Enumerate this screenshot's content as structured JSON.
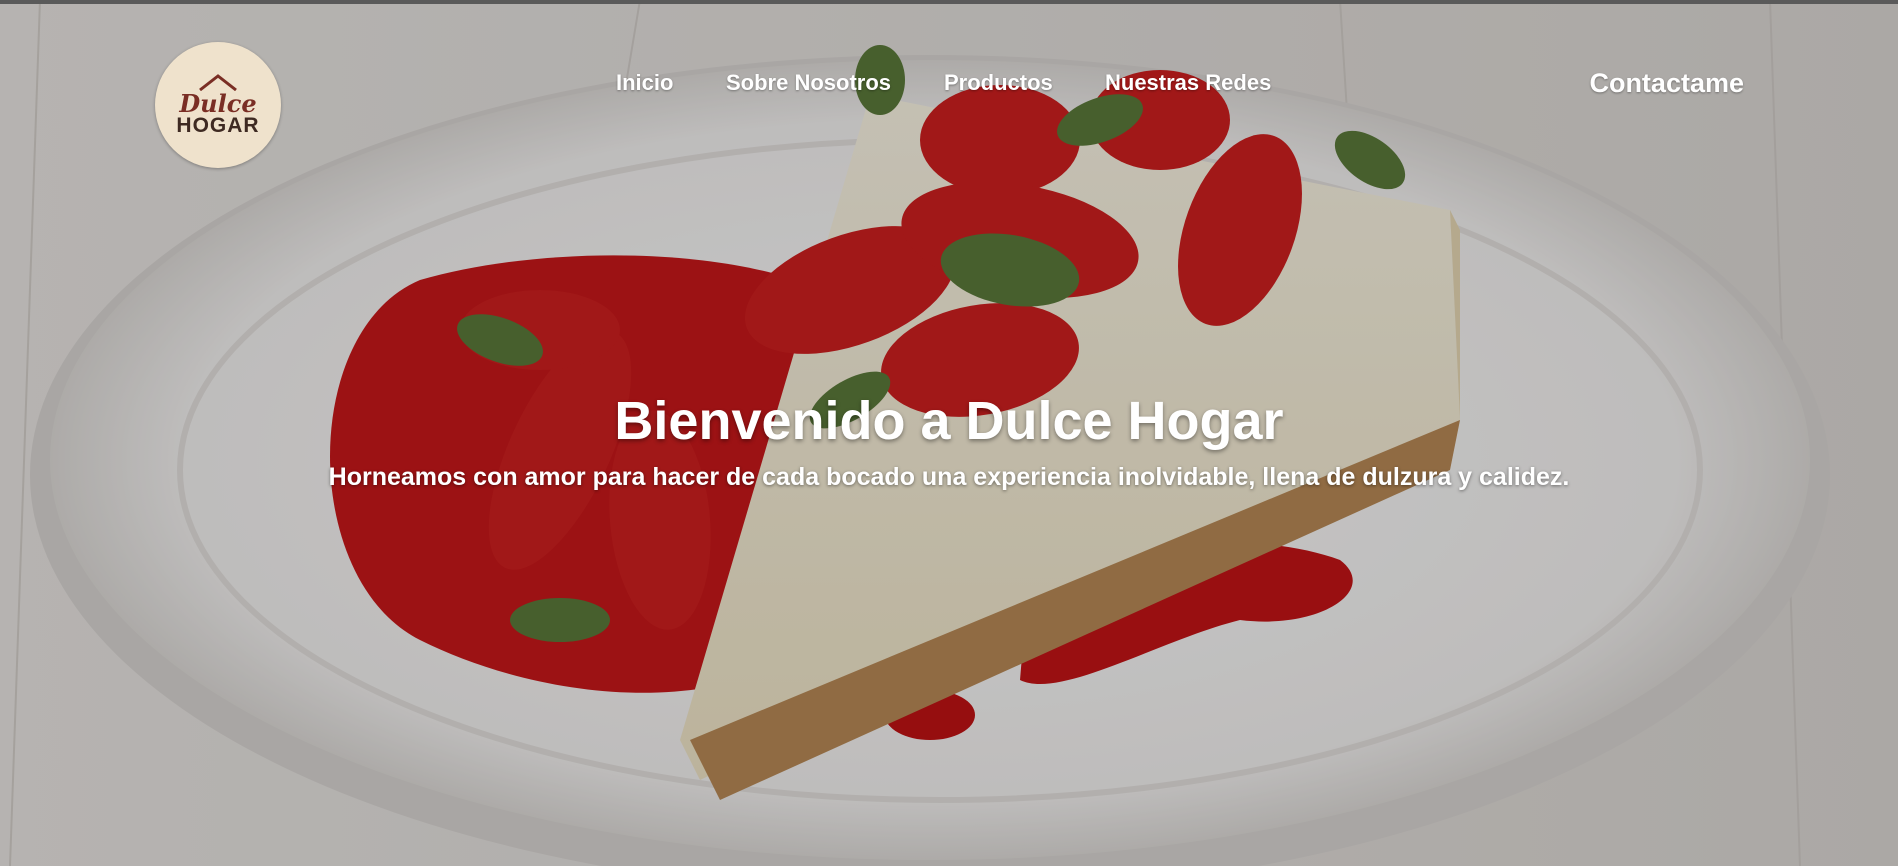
{
  "brand": {
    "logo_line1": "Dulce",
    "logo_line2": "HOGAR"
  },
  "nav": {
    "items": [
      {
        "label": "Inicio"
      },
      {
        "label": "Sobre Nosotros"
      },
      {
        "label": "Productos"
      },
      {
        "label": "Nuestras Redes"
      }
    ],
    "contact_label": "Contactame"
  },
  "hero": {
    "title": "Bienvenido a Dulce Hogar",
    "subtitle": "Horneamos con amor para hacer de cada bocado una experiencia inolvidable, llena de dulzura y calidez.",
    "image_subject": "strawberry-cheesecake-slice",
    "colors": {
      "overlay": "#000000",
      "text": "#ffffff",
      "strawberry": "#c8181a",
      "plate": "#f2f0ee"
    }
  }
}
